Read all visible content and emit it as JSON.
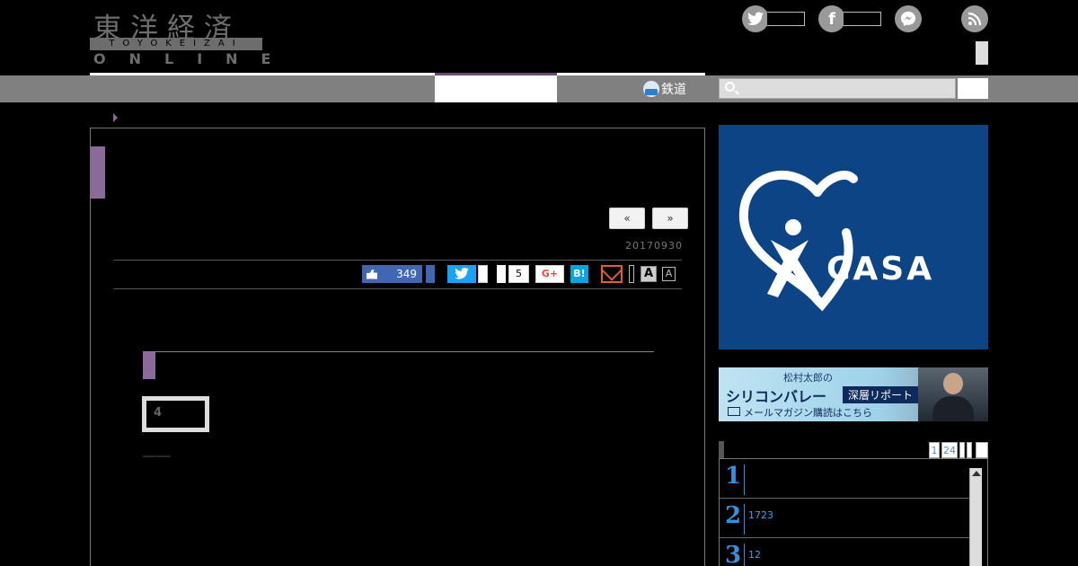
{
  "header": {
    "logo_kanji": "東洋経済",
    "logo_roman": "TOYOKEIZAI",
    "logo_online": "ONLINE"
  },
  "icons": {
    "twitter": "twitter-icon",
    "facebook": "facebook-icon",
    "messenger": "messenger-icon",
    "rss": "rss-icon",
    "search": "search-icon"
  },
  "nav": {
    "railway_label": "鉄道"
  },
  "article": {
    "prev_label": "«",
    "next_label": "»",
    "date": "20170930",
    "like_count": "349",
    "pocket_count": "5",
    "gplus_label": "G+",
    "hatena_label": "B!",
    "font_large": "A",
    "font_small": "A",
    "paragraph1": "",
    "heading2": "",
    "page_indicator": "4",
    "paragraph2": "――",
    "paragraph3": ""
  },
  "sidebar": {
    "ad_casa_word": "CASA",
    "ad_sv_small": "松村太郎の",
    "ad_sv_main": "シリコンバレー",
    "ad_sv_tag": "深層リポート",
    "ad_sv_bottom": "メールマガジン購読はこちら",
    "rank_tabs": [
      "1",
      "24",
      "",
      "",
      ""
    ],
    "ranking": [
      {
        "num": "1",
        "text": ""
      },
      {
        "num": "2",
        "text": "1723"
      },
      {
        "num": "3",
        "text": "12"
      }
    ]
  },
  "colors": {
    "accent_purple": "#8a6a99",
    "facebook_blue": "#4267b2",
    "twitter_blue": "#1da1f2",
    "casa_blue": "#0c4485",
    "rank_blue": "#3b8fd8"
  }
}
